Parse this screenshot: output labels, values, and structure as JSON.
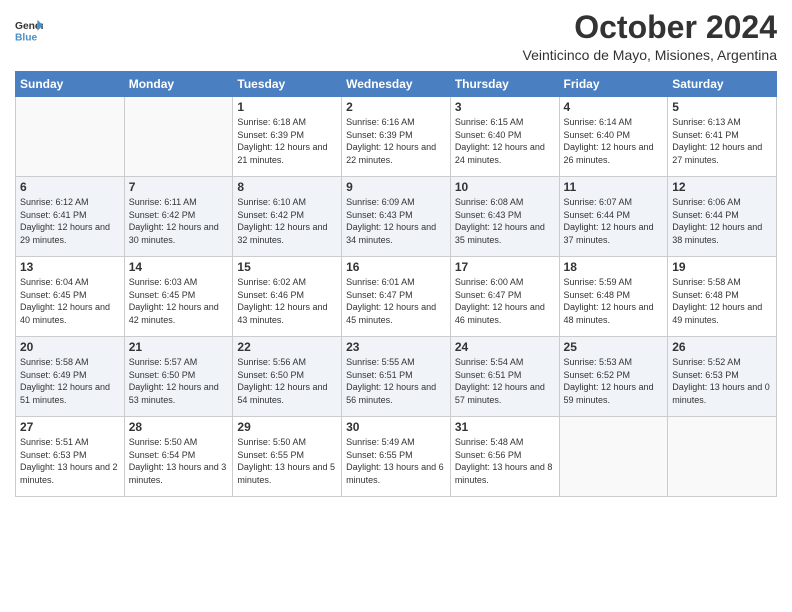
{
  "logo": {
    "line1": "General",
    "line2": "Blue"
  },
  "title": "October 2024",
  "location": "Veinticinco de Mayo, Misiones, Argentina",
  "days_of_week": [
    "Sunday",
    "Monday",
    "Tuesday",
    "Wednesday",
    "Thursday",
    "Friday",
    "Saturday"
  ],
  "weeks": [
    [
      {
        "day": "",
        "info": ""
      },
      {
        "day": "",
        "info": ""
      },
      {
        "day": "1",
        "info": "Sunrise: 6:18 AM\nSunset: 6:39 PM\nDaylight: 12 hours and 21 minutes."
      },
      {
        "day": "2",
        "info": "Sunrise: 6:16 AM\nSunset: 6:39 PM\nDaylight: 12 hours and 22 minutes."
      },
      {
        "day": "3",
        "info": "Sunrise: 6:15 AM\nSunset: 6:40 PM\nDaylight: 12 hours and 24 minutes."
      },
      {
        "day": "4",
        "info": "Sunrise: 6:14 AM\nSunset: 6:40 PM\nDaylight: 12 hours and 26 minutes."
      },
      {
        "day": "5",
        "info": "Sunrise: 6:13 AM\nSunset: 6:41 PM\nDaylight: 12 hours and 27 minutes."
      }
    ],
    [
      {
        "day": "6",
        "info": "Sunrise: 6:12 AM\nSunset: 6:41 PM\nDaylight: 12 hours and 29 minutes."
      },
      {
        "day": "7",
        "info": "Sunrise: 6:11 AM\nSunset: 6:42 PM\nDaylight: 12 hours and 30 minutes."
      },
      {
        "day": "8",
        "info": "Sunrise: 6:10 AM\nSunset: 6:42 PM\nDaylight: 12 hours and 32 minutes."
      },
      {
        "day": "9",
        "info": "Sunrise: 6:09 AM\nSunset: 6:43 PM\nDaylight: 12 hours and 34 minutes."
      },
      {
        "day": "10",
        "info": "Sunrise: 6:08 AM\nSunset: 6:43 PM\nDaylight: 12 hours and 35 minutes."
      },
      {
        "day": "11",
        "info": "Sunrise: 6:07 AM\nSunset: 6:44 PM\nDaylight: 12 hours and 37 minutes."
      },
      {
        "day": "12",
        "info": "Sunrise: 6:06 AM\nSunset: 6:44 PM\nDaylight: 12 hours and 38 minutes."
      }
    ],
    [
      {
        "day": "13",
        "info": "Sunrise: 6:04 AM\nSunset: 6:45 PM\nDaylight: 12 hours and 40 minutes."
      },
      {
        "day": "14",
        "info": "Sunrise: 6:03 AM\nSunset: 6:45 PM\nDaylight: 12 hours and 42 minutes."
      },
      {
        "day": "15",
        "info": "Sunrise: 6:02 AM\nSunset: 6:46 PM\nDaylight: 12 hours and 43 minutes."
      },
      {
        "day": "16",
        "info": "Sunrise: 6:01 AM\nSunset: 6:47 PM\nDaylight: 12 hours and 45 minutes."
      },
      {
        "day": "17",
        "info": "Sunrise: 6:00 AM\nSunset: 6:47 PM\nDaylight: 12 hours and 46 minutes."
      },
      {
        "day": "18",
        "info": "Sunrise: 5:59 AM\nSunset: 6:48 PM\nDaylight: 12 hours and 48 minutes."
      },
      {
        "day": "19",
        "info": "Sunrise: 5:58 AM\nSunset: 6:48 PM\nDaylight: 12 hours and 49 minutes."
      }
    ],
    [
      {
        "day": "20",
        "info": "Sunrise: 5:58 AM\nSunset: 6:49 PM\nDaylight: 12 hours and 51 minutes."
      },
      {
        "day": "21",
        "info": "Sunrise: 5:57 AM\nSunset: 6:50 PM\nDaylight: 12 hours and 53 minutes."
      },
      {
        "day": "22",
        "info": "Sunrise: 5:56 AM\nSunset: 6:50 PM\nDaylight: 12 hours and 54 minutes."
      },
      {
        "day": "23",
        "info": "Sunrise: 5:55 AM\nSunset: 6:51 PM\nDaylight: 12 hours and 56 minutes."
      },
      {
        "day": "24",
        "info": "Sunrise: 5:54 AM\nSunset: 6:51 PM\nDaylight: 12 hours and 57 minutes."
      },
      {
        "day": "25",
        "info": "Sunrise: 5:53 AM\nSunset: 6:52 PM\nDaylight: 12 hours and 59 minutes."
      },
      {
        "day": "26",
        "info": "Sunrise: 5:52 AM\nSunset: 6:53 PM\nDaylight: 13 hours and 0 minutes."
      }
    ],
    [
      {
        "day": "27",
        "info": "Sunrise: 5:51 AM\nSunset: 6:53 PM\nDaylight: 13 hours and 2 minutes."
      },
      {
        "day": "28",
        "info": "Sunrise: 5:50 AM\nSunset: 6:54 PM\nDaylight: 13 hours and 3 minutes."
      },
      {
        "day": "29",
        "info": "Sunrise: 5:50 AM\nSunset: 6:55 PM\nDaylight: 13 hours and 5 minutes."
      },
      {
        "day": "30",
        "info": "Sunrise: 5:49 AM\nSunset: 6:55 PM\nDaylight: 13 hours and 6 minutes."
      },
      {
        "day": "31",
        "info": "Sunrise: 5:48 AM\nSunset: 6:56 PM\nDaylight: 13 hours and 8 minutes."
      },
      {
        "day": "",
        "info": ""
      },
      {
        "day": "",
        "info": ""
      }
    ]
  ]
}
